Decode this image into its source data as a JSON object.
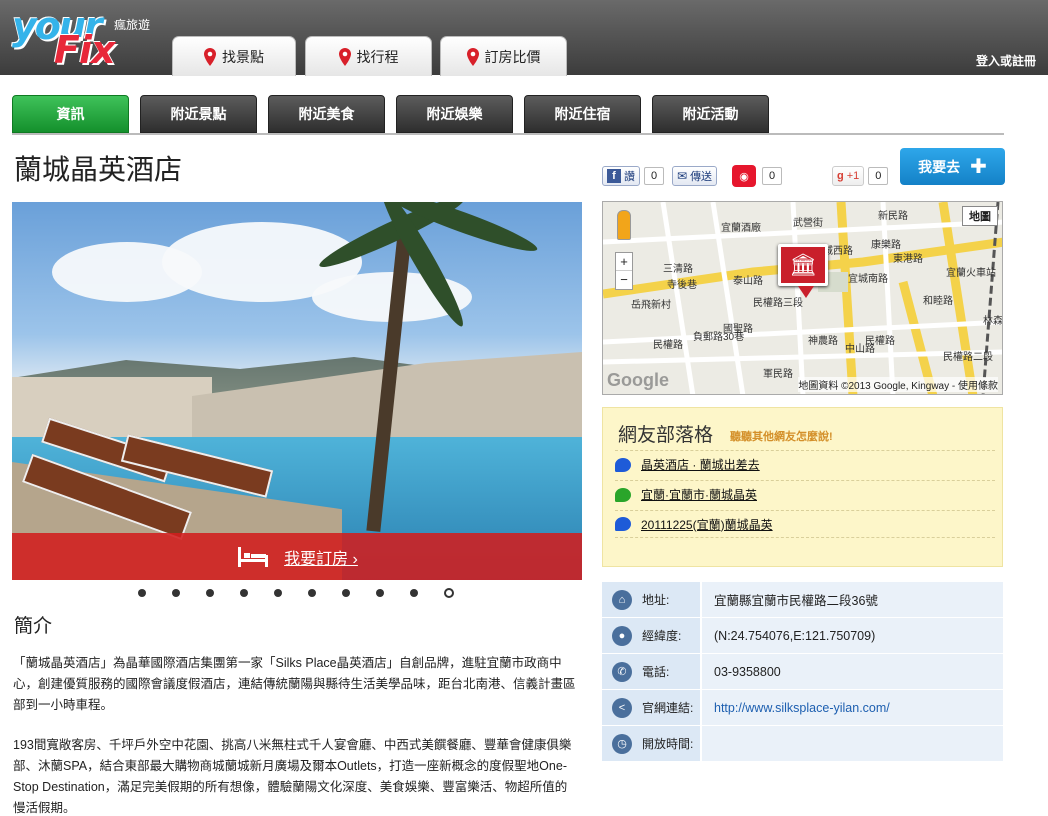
{
  "brand": {
    "logo_you": "your",
    "logo_fix": "Fix",
    "tagline": "瘋旅遊"
  },
  "top_nav": [
    {
      "label": "找景點"
    },
    {
      "label": "找行程"
    },
    {
      "label": "訂房比價"
    }
  ],
  "login_label": "登入或註冊",
  "sub_tabs": [
    {
      "label": "資訊",
      "active": true
    },
    {
      "label": "附近景點"
    },
    {
      "label": "附近美食"
    },
    {
      "label": "附近娛樂"
    },
    {
      "label": "附近住宿"
    },
    {
      "label": "附近活動"
    }
  ],
  "page_title": "蘭城晶英酒店",
  "book_label": "我要訂房 ›",
  "carousel": {
    "count": 10,
    "active_index": 9
  },
  "intro": {
    "heading": "簡介",
    "p1": "「蘭城晶英酒店」為晶華國際酒店集團第一家「Silks Place晶英酒店」自創品牌，進駐宜蘭市政商中心，創建優質服務的國際會議度假酒店，連結傳統蘭陽與縣待生活美學品味，距台北南港、信義計畫區部到一小時車程。",
    "p2": "193間寬敞客房、千坪戶外空中花園、挑高八米無柱式千人宴會廳、中西式美饌餐廳、豐華會健康俱樂部、沐蘭SPA，結合東部最大購物商城蘭城新月廣場及爾本Outlets，打造一座新概念的度假聖地One-Stop Destination，滿足完美假期的所有想像，體驗蘭陽文化深度、美食娛樂、豐富樂活、物超所值的慢活假期。"
  },
  "social": {
    "fb_label": "讚",
    "fb_count": "0",
    "send_label": "傳送",
    "weibo_count": "0",
    "gplus_label": "+1",
    "gplus_count": "0"
  },
  "go_button": "我要去",
  "map": {
    "type_button": "地圖",
    "credit": "地圖資料 ©2013 Google, Kingway - 使用條款",
    "watermark": "Google",
    "labels": [
      "宜蘭酒廠",
      "武營街",
      "新民路",
      "康樂路",
      "東港路",
      "宜蘭火車站",
      "三清路",
      "寺後巷",
      "岳飛新村",
      "泰山路",
      "民權路",
      "宜城南路",
      "舊城西路",
      "民權路三段",
      "負郵路30巷",
      "國聖路",
      "神農路",
      "中山路",
      "和睦路",
      "林森路",
      "民權路",
      "民權路二段",
      "軍民路"
    ],
    "zoom_in": "+",
    "zoom_out": "−"
  },
  "blog": {
    "heading": "網友部落格",
    "subheading": "聽聽其他網友怎麼說!",
    "items": [
      {
        "title": "晶英酒店 · 蘭城出差去",
        "icon": "blue-bubble-icon"
      },
      {
        "title": "宜蘭·宜蘭市·蘭城晶英",
        "icon": "green-bubble-icon"
      },
      {
        "title": "20111225(宜蘭)蘭城晶英",
        "icon": "blue-bubble-icon"
      }
    ]
  },
  "info": [
    {
      "key": "地址:",
      "value": "宜蘭縣宜蘭市民權路二段36號",
      "icon": "home-icon"
    },
    {
      "key": "經緯度:",
      "value": "(N:24.754076,E:121.750709)",
      "icon": "location-icon"
    },
    {
      "key": "電話:",
      "value": "03-9358800",
      "icon": "phone-icon"
    },
    {
      "key": "官網連結:",
      "value": "http://www.silksplace-yilan.com/",
      "icon": "share-icon"
    },
    {
      "key": "開放時間:",
      "value": "",
      "icon": "clock-icon"
    }
  ],
  "colors": {
    "active_tab": "#14902c",
    "accent_blue": "#1481c7",
    "book_red": "#d21e1e",
    "blog_bg": "#fdf6c9"
  }
}
